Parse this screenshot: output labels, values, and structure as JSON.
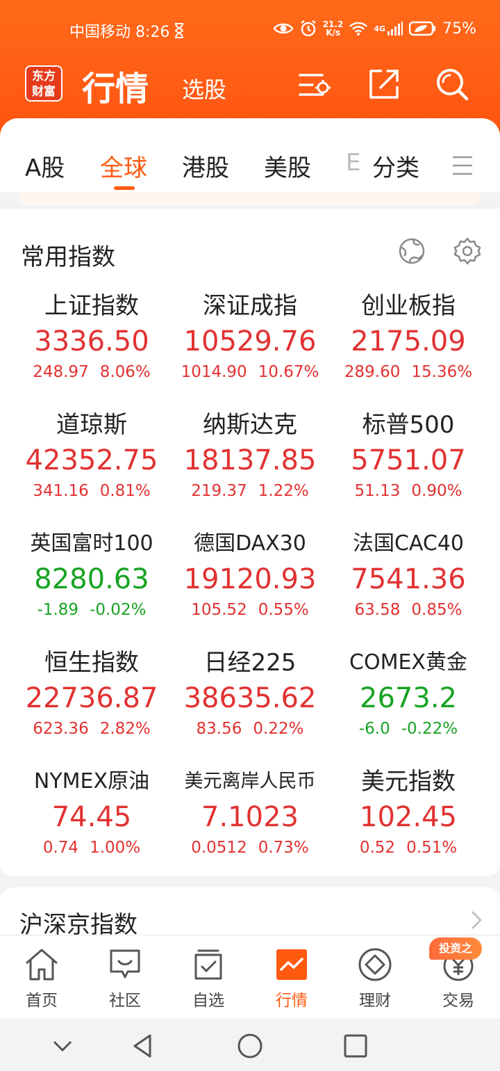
{
  "status": {
    "carrier_time": "中国移动 8:26",
    "speed_top": "21.2",
    "speed_bottom": "K/s",
    "network": "4G",
    "battery": "75%"
  },
  "header": {
    "logo_line1": "东方",
    "logo_line2": "财富",
    "title": "行情",
    "subtitle": "选股"
  },
  "tabs": [
    {
      "label": "A股"
    },
    {
      "label": "全球"
    },
    {
      "label": "港股"
    },
    {
      "label": "美股"
    },
    {
      "label": "E"
    },
    {
      "label": "分类"
    }
  ],
  "common": {
    "title": "常用指数",
    "items": [
      {
        "name": "上证指数",
        "price": "3336.50",
        "change": "248.97",
        "pct": "8.06%"
      },
      {
        "name": "深证成指",
        "price": "10529.76",
        "change": "1014.90",
        "pct": "10.67%"
      },
      {
        "name": "创业板指",
        "price": "2175.09",
        "change": "289.60",
        "pct": "15.36%"
      },
      {
        "name": "道琼斯",
        "price": "42352.75",
        "change": "341.16",
        "pct": "0.81%"
      },
      {
        "name": "纳斯达克",
        "price": "18137.85",
        "change": "219.37",
        "pct": "1.22%"
      },
      {
        "name": "标普500",
        "price": "5751.07",
        "change": "51.13",
        "pct": "0.90%"
      },
      {
        "name": "英国富时100",
        "price": "8280.63",
        "change": "-1.89",
        "pct": "-0.02%"
      },
      {
        "name": "德国DAX30",
        "price": "19120.93",
        "change": "105.52",
        "pct": "0.55%"
      },
      {
        "name": "法国CAC40",
        "price": "7541.36",
        "change": "63.58",
        "pct": "0.85%"
      },
      {
        "name": "恒生指数",
        "price": "22736.87",
        "change": "623.36",
        "pct": "2.82%"
      },
      {
        "name": "日经225",
        "price": "38635.62",
        "change": "83.56",
        "pct": "0.22%"
      },
      {
        "name": "COMEX黄金",
        "price": "2673.2",
        "change": "-6.0",
        "pct": "-0.22%"
      },
      {
        "name": "NYMEX原油",
        "price": "74.45",
        "change": "0.74",
        "pct": "1.00%"
      },
      {
        "name": "美元离岸人民币",
        "price": "7.1023",
        "change": "0.0512",
        "pct": "0.73%"
      },
      {
        "name": "美元指数",
        "price": "102.45",
        "change": "0.52",
        "pct": "0.51%"
      }
    ]
  },
  "section2": {
    "title": "沪深京指数"
  },
  "nav": [
    {
      "label": "首页"
    },
    {
      "label": "社区"
    },
    {
      "label": "自选"
    },
    {
      "label": "行情"
    },
    {
      "label": "理财"
    },
    {
      "label": "交易"
    }
  ],
  "badge": "投资之",
  "colors": {
    "brand": "#ff5a10",
    "up": "#e23131",
    "down": "#17a322"
  }
}
